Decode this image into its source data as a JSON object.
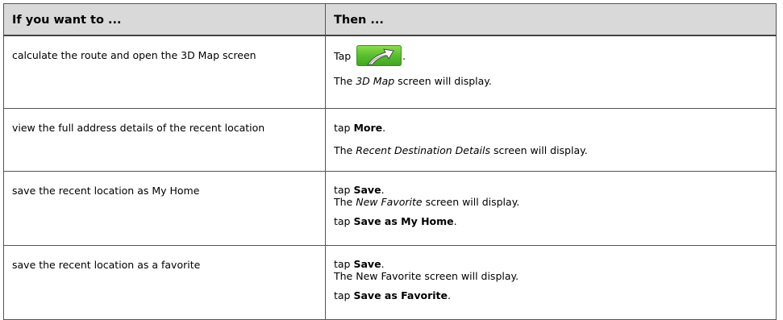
{
  "table": {
    "headers": [
      "If you want to ...",
      "Then ..."
    ],
    "rows": [
      {
        "action": "calculate the route and open the 3D Map screen",
        "tap_prefix": "Tap",
        "tap_suffix": ".",
        "result_screen": "3D Map",
        "result_suffix": "screen will display."
      },
      {
        "action": "view the full address details of the recent location",
        "tap_prefix": "tap",
        "button": "More",
        "tap_suffix": ".",
        "result_prefix": "The",
        "result_screen": "Recent Destination Details",
        "result_suffix": "screen will display."
      },
      {
        "action": "save the recent location as My Home",
        "tap_prefix": "tap",
        "button": "Save",
        "tap_suffix": ".",
        "result_prefix": "The",
        "result_screen": "New Favorite",
        "result_suffix": "screen will display.",
        "second_tap_prefix": "tap",
        "second_button": "Save as My Home",
        "second_tap_suffix": "."
      },
      {
        "action": "save the recent location as a favorite",
        "tap_prefix": "tap",
        "button": "Save",
        "tap_suffix": ".",
        "result_text": "The New Favorite screen will display.",
        "second_tap_prefix": "tap",
        "second_button": "Save as Favorite",
        "second_tap_suffix": "."
      }
    ]
  },
  "icons": {
    "route_button": "route-arrow-icon"
  },
  "colors": {
    "header_bg": "#d9d9d9",
    "route_button_green": "#5cc232"
  }
}
